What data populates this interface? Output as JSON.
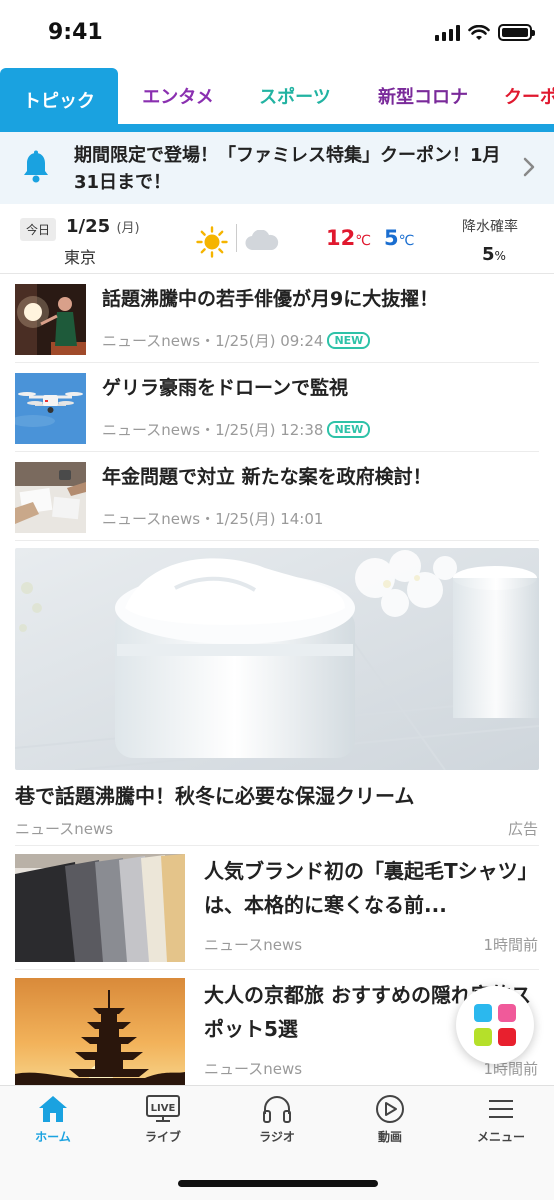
{
  "status": {
    "time": "9:41"
  },
  "tabs": [
    {
      "label": "トピック",
      "color": "#ffffff",
      "active": true
    },
    {
      "label": "エンタメ",
      "color": "#8a2fb0"
    },
    {
      "label": "スポーツ",
      "color": "#22b3a2"
    },
    {
      "label": "新型コロナ",
      "color": "#7a2a9a"
    },
    {
      "label": "クーポ",
      "color": "#e0182e"
    }
  ],
  "notice": {
    "text": "期間限定で登場！「ファミレス特集」クーポン！1月31日まで！"
  },
  "weather": {
    "today": "今日",
    "date": "1/25",
    "dow": "(月)",
    "city": "東京",
    "high": "12",
    "low": "5",
    "unit": "℃",
    "rain_label": "降水確率",
    "rain_value": "5",
    "rain_unit": "%"
  },
  "news": [
    {
      "title": "話題沸騰中の若手俳優が月9に大抜擢！",
      "meta": "ニュースnews・1/25(月) 09:24",
      "badge": "NEW"
    },
    {
      "title": "ゲリラ豪雨をドローンで監視",
      "meta": "ニュースnews・1/25(月) 12:38",
      "badge": "NEW"
    },
    {
      "title": "年金問題で対立 新たな案を政府検討！",
      "meta": "ニュースnews・1/25(月) 14:01",
      "badge": ""
    }
  ],
  "ad": {
    "title": "巷で話題沸騰中！秋冬に必要な保湿クリーム",
    "source": "ニュースnews",
    "label": "広告"
  },
  "articles": [
    {
      "title": "人気ブランド初の「裏起毛Tシャツ」は、本格的に寒くなる前...",
      "source": "ニュースnews",
      "time": "1時間前"
    },
    {
      "title": "大人の京都旅 おすすめの隠れ家的スポット5選",
      "source": "ニュースnews",
      "time": "1時間前"
    }
  ],
  "bottom_nav": [
    {
      "label": "ホーム",
      "icon": "home-icon",
      "active": true
    },
    {
      "label": "ライブ",
      "icon": "live-tv-icon"
    },
    {
      "label": "ラジオ",
      "icon": "headphones-icon"
    },
    {
      "label": "動画",
      "icon": "play-icon"
    },
    {
      "label": "メニュー",
      "icon": "menu-icon"
    }
  ],
  "colors": {
    "accent": "#1aa2e0",
    "new_badge": "#2ec2a8",
    "high_temp": "#e0182e",
    "low_temp": "#1a6ed0"
  }
}
